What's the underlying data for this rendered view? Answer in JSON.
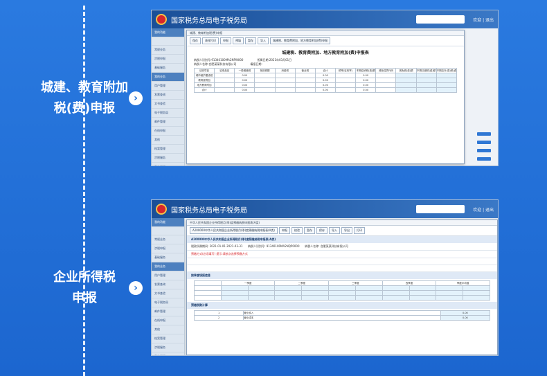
{
  "sections": [
    {
      "title": "城建、教育附加\n税(费)申报"
    },
    {
      "title": "企业所得税\n申报"
    }
  ],
  "app": {
    "title": "国家税务总局电子税务局"
  },
  "sidebar_items": [
    "我的功能",
    "",
    "常规业务",
    "涉税申报",
    "基础服务",
    "我的业务",
    "用户管理",
    "发票查询",
    "文书查验",
    "电子税务局",
    "邮件管理",
    "在线申报",
    "其他",
    "档案管理",
    "涉税服务",
    "我的证照",
    "通知公告"
  ],
  "doc1": {
    "bar": "城建、教育附加税(费)申报",
    "buttons": [
      "保存",
      "表样打印",
      "申报",
      "预填",
      "暂存",
      "导入",
      "城建税、教育费附加、地方教育附加(费)申报"
    ],
    "title": "城建税、教育费附加、地方教育附加(费)申报表",
    "taxpayer_id_label": "纳税人识别号:",
    "taxpayer_id": "91340100MA2NPW000",
    "taxpayer_name_label": "纳税人名称:",
    "taxpayer_name": "合肥某某科技有限公司",
    "period_label": "所属日期:",
    "period": "2021年03月01日",
    "fill_date_label": "填报日期:",
    "taxpayer_info": "纳税人信息",
    "rows": [
      "城市维护建设税",
      "教育费附加",
      "地方教育附加",
      "合计"
    ],
    "headers": [
      "征收项目",
      "征收品目",
      "一般增值税",
      "免抵税额",
      "消费税",
      "营业税",
      "合计",
      "税率(征收率)",
      "本期应纳税(费)额",
      "减免性质代码",
      "减免税(费)额",
      "本期已缴税(费)额",
      "本期应补(退)税(费)额"
    ],
    "values": [
      "0.00",
      "0.00",
      "0.00",
      "0.00"
    ]
  },
  "doc2": {
    "bar": "中华人民共和国企业所得税月(季)度预缴纳税申报表(A类)",
    "tab": "A200000中华人民共和国企业所得税月(季)度预缴纳税申报表(A类)",
    "buttons": [
      "申报",
      "校验",
      "暂存",
      "保存",
      "导入",
      "导出",
      "打印"
    ],
    "title": "A200000中华人民共和国企业所得税月(季)度预缴纳税申报表(A类)",
    "period_label": "税款所属期间:",
    "period": "2021-01-01 2021-03-31",
    "taxpayer_id_label": "纳税人识别号:",
    "taxpayer_id": "91340100MA2NQP0000",
    "taxpayer_name_label": "纳税人名称:",
    "taxpayer_name": "合肥某某科技有限公司",
    "notice": "预缴方式(必须填写) 提示:请依次选择预缴方式",
    "section1": "按季度填报信息",
    "quarters": [
      "一季度",
      "二季度",
      "三季度",
      "四季度",
      "季度平均值"
    ],
    "section2": "预缴税款计算",
    "items": [
      "营业收入",
      "营业成本"
    ],
    "amount": "0.00"
  }
}
